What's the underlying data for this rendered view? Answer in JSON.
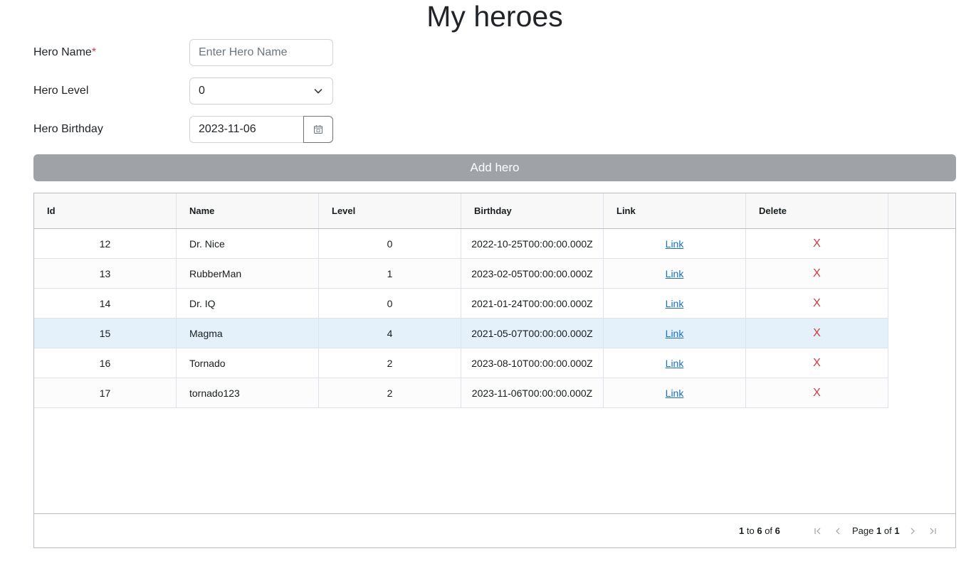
{
  "page": {
    "title": "My heroes"
  },
  "form": {
    "name_label": "Hero Name",
    "required_marker": "*",
    "name_placeholder": "Enter Hero Name",
    "name_value": "",
    "level_label": "Hero Level",
    "level_value": "0",
    "birthday_label": "Hero Birthday",
    "birthday_value": "2023-11-06",
    "add_button": "Add hero"
  },
  "grid": {
    "columns": [
      "Id",
      "Name",
      "Level",
      "Birthday",
      "Link",
      "Delete"
    ],
    "rows": [
      {
        "id": "12",
        "name": "Dr. Nice",
        "level": "0",
        "birthday": "2022-10-25T00:00:00.000Z",
        "link": "Link",
        "delete": "X"
      },
      {
        "id": "13",
        "name": "RubberMan",
        "level": "1",
        "birthday": "2023-02-05T00:00:00.000Z",
        "link": "Link",
        "delete": "X"
      },
      {
        "id": "14",
        "name": "Dr. IQ",
        "level": "0",
        "birthday": "2021-01-24T00:00:00.000Z",
        "link": "Link",
        "delete": "X"
      },
      {
        "id": "15",
        "name": "Magma",
        "level": "4",
        "birthday": "2021-05-07T00:00:00.000Z",
        "link": "Link",
        "delete": "X"
      },
      {
        "id": "16",
        "name": "Tornado",
        "level": "2",
        "birthday": "2023-08-10T00:00:00.000Z",
        "link": "Link",
        "delete": "X"
      },
      {
        "id": "17",
        "name": "tornado123",
        "level": "2",
        "birthday": "2023-11-06T00:00:00.000Z",
        "link": "Link",
        "delete": "X"
      }
    ],
    "selected_row_index": 3
  },
  "pagination": {
    "from": "1",
    "to_word": "to",
    "to": "6",
    "of_word": "of",
    "total": "6",
    "page_word": "Page",
    "page": "1",
    "page_of_word": "of",
    "pages": "1",
    "icons": [
      "first-page-icon",
      "previous-page-icon",
      "next-page-icon",
      "last-page-icon"
    ]
  },
  "colors": {
    "add_button_bg": "#9fa3a8",
    "selected_row_bg": "#e4f1fa",
    "delete_red": "#d9363e",
    "link_blue": "#1a6fc4",
    "required_red": "#dc3545"
  }
}
